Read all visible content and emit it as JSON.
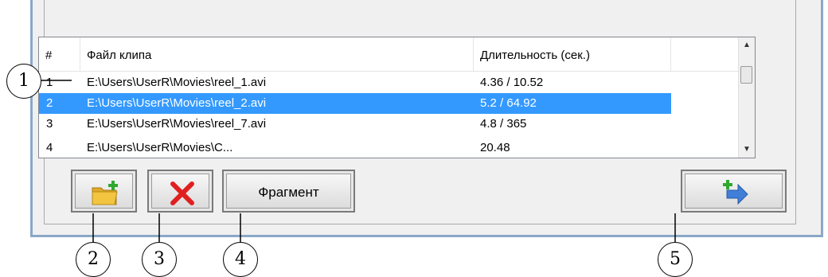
{
  "table": {
    "headers": {
      "num": "#",
      "file": "Файл клипа",
      "duration": "Длительность (сек.)"
    },
    "rows": [
      {
        "num": "1",
        "file": "E:\\Users\\UserR\\Movies\\reel_1.avi",
        "duration": "4.36 / 10.52",
        "selected": false
      },
      {
        "num": "2",
        "file": "E:\\Users\\UserR\\Movies\\reel_2.avi",
        "duration": "5.2 / 64.92",
        "selected": true
      },
      {
        "num": "3",
        "file": "E:\\Users\\UserR\\Movies\\reel_7.avi",
        "duration": "4.8 / 365",
        "selected": false
      },
      {
        "num": "4",
        "file": "E:\\Users\\UserR\\Movies\\C...",
        "duration": "20.48",
        "selected": false
      }
    ]
  },
  "buttons": {
    "open_icon": "folder-add-icon",
    "delete_icon": "red-x-icon",
    "fragment_label": "Фрагмент",
    "add_icon": "add-arrow-icon"
  },
  "callouts": [
    "1",
    "2",
    "3",
    "4",
    "5"
  ],
  "colors": {
    "selection": "#3399ff",
    "delete_x": "#e02020",
    "folder": "#f3c440",
    "plus": "#2ea82e",
    "arrow": "#3f7fd8"
  }
}
